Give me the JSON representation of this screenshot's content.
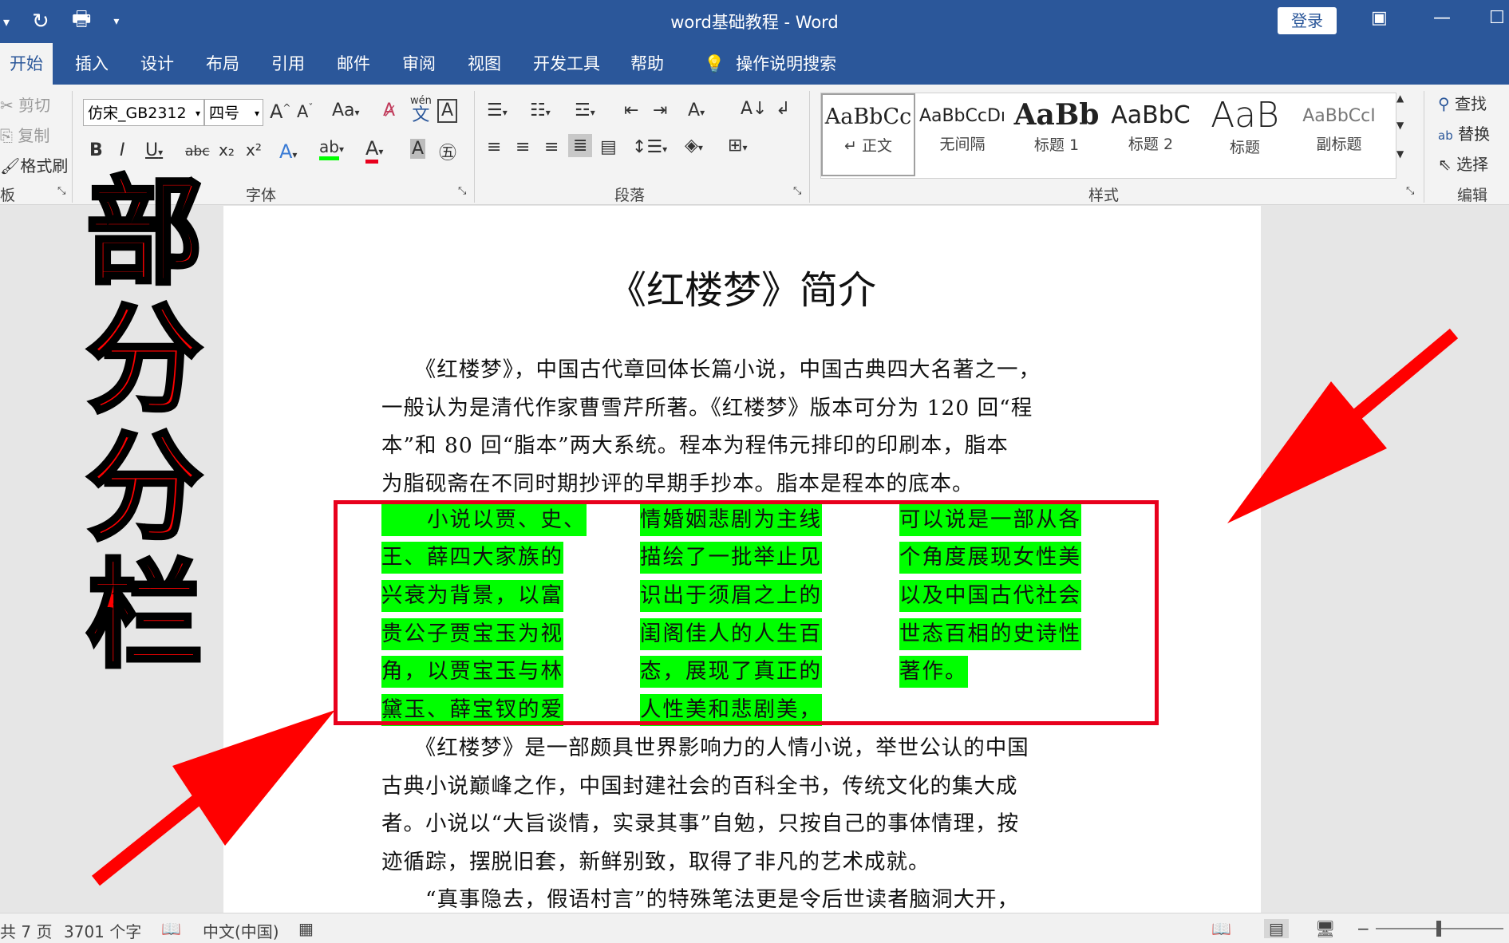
{
  "titlebar": {
    "title": "word基础教程 - Word",
    "login_label": "登录",
    "undo_icon": "dropdown-caret",
    "redo_icon": "redo-icon",
    "print_preview_icon": "print-preview-icon"
  },
  "tabs": [
    "开始",
    "插入",
    "设计",
    "布局",
    "引用",
    "邮件",
    "审阅",
    "视图",
    "开发工具",
    "帮助"
  ],
  "tell_me": "操作说明搜索",
  "clipboard": {
    "cut": "剪切",
    "copy": "复制",
    "format_painter": "格式刷",
    "group_label": "板"
  },
  "font": {
    "name": "仿宋_GB2312",
    "size": "四号",
    "case_label": "Aa",
    "pinyin_top": "wén",
    "pinyin_char": "文",
    "border_char": "A",
    "bold": "B",
    "italic": "I",
    "underline": "U",
    "strike": "abc",
    "subscript": "x₂",
    "superscript": "x²",
    "group_label": "字体",
    "font_color": "#e8001c",
    "highlight_color": "#00ff00"
  },
  "paragraph": {
    "group_label": "段落"
  },
  "styles": {
    "group_label": "样式",
    "items": [
      {
        "sample": "AaBbCc",
        "name": "↵ 正文"
      },
      {
        "sample": "AaBbCcDı",
        "name": "无间隔"
      },
      {
        "sample": "AaBb",
        "name": "标题 1"
      },
      {
        "sample": "AaBbC",
        "name": "标题 2"
      },
      {
        "sample": "AaB",
        "name": "标题"
      },
      {
        "sample": "AaBbCcI",
        "name": "副标题"
      }
    ]
  },
  "editing": {
    "find": "查找",
    "replace": "替换",
    "select": "选择",
    "group_label": "编辑"
  },
  "overlay_text": [
    "部",
    "分",
    "分",
    "栏"
  ],
  "document": {
    "heading": "《红楼梦》简介",
    "para1": [
      "　　《红楼梦》，中国古代章回体长篇小说，中国古典四大名著之一，",
      "一般认为是清代作家曹雪芹所著。《红楼梦》版本可分为 120 回“程",
      "本”和 80 回“脂本”两大系统。程本为程伟元排印的印刷本，脂本",
      "为脂砚斋在不同时期抄评的早期手抄本。脂本是程本的底本。"
    ],
    "columns": [
      [
        "　　小说以贾、史、",
        "王、薛四大家族的",
        "兴衰为背景，以富",
        "贵公子贾宝玉为视",
        "角，以贾宝玉与林",
        "黛玉、薛宝钗的爱"
      ],
      [
        "情婚姻悲剧为主线",
        "描绘了一批举止见",
        "识出于须眉之上的",
        "闺阁佳人的人生百",
        "态，展现了真正的",
        "人性美和悲剧美，"
      ],
      [
        "可以说是一部从各",
        "个角度展现女性美",
        "以及中国古代社会",
        "世态百相的史诗性",
        "著作。"
      ]
    ],
    "para2": [
      "　　《红楼梦》是一部颇具世界影响力的人情小说，举世公认的中国",
      "古典小说巅峰之作，中国封建社会的百科全书，传统文化的集大成",
      "者。小说以“大旨谈情，实录其事”自勉，只按自己的事体情理，按",
      "迹循踪，摆脱旧套，新鲜别致，取得了非凡的艺术成就。",
      "　　“真事隐去，假语村言”的特殊笔法更是令后世读者脑洞大开，"
    ]
  },
  "status": {
    "pages": "共 7 页",
    "words": "3701 个字",
    "language": "中文(中国)"
  },
  "colors": {
    "accent": "#2b579a",
    "overlay_red": "#ff0000",
    "highlight": "#00ff00",
    "box_red": "#e8001c"
  }
}
